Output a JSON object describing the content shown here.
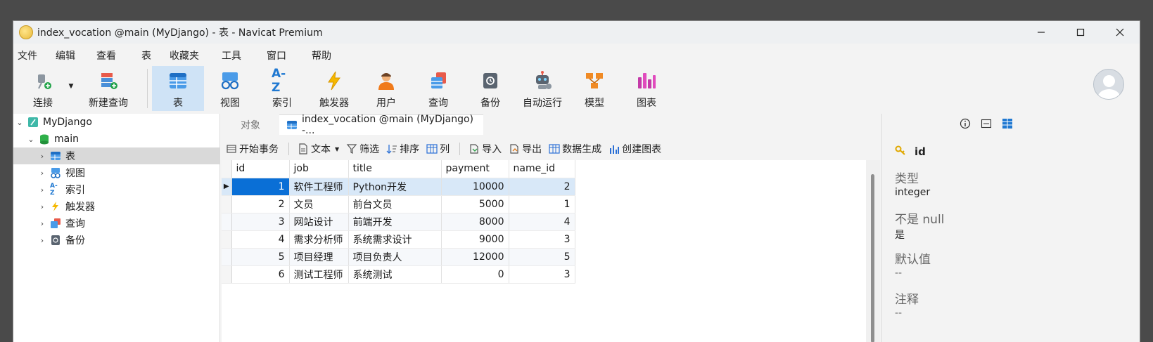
{
  "window": {
    "title": "index_vocation @main (MyDjango) - 表 - Navicat Premium",
    "controls": {
      "minimize": "—",
      "maximize": "☐",
      "close": "✕"
    }
  },
  "menu": [
    "文件",
    "编辑",
    "查看",
    "表",
    "收藏夹",
    "工具",
    "窗口",
    "帮助"
  ],
  "toolbar": {
    "connect": "连接",
    "new_query": "新建查询",
    "table": "表",
    "view": "视图",
    "index": "索引",
    "trigger": "触发器",
    "user": "用户",
    "query": "查询",
    "backup": "备份",
    "auto_run": "自动运行",
    "model": "模型",
    "chart": "图表",
    "index_icon_text": "A-Z"
  },
  "sidebar": {
    "connection": "MyDjango",
    "database": "main",
    "items": [
      "表",
      "视图",
      "索引",
      "触发器",
      "查询",
      "备份"
    ]
  },
  "tabs": {
    "objects": "对象",
    "active": "index_vocation @main (MyDjango) -..."
  },
  "obj_toolbar": {
    "begin_tx": "开始事务",
    "text": "文本",
    "filter": "筛选",
    "sort": "排序",
    "columns": "列",
    "import": "导入",
    "export": "导出",
    "data_gen": "数据生成",
    "create_chart": "创建图表"
  },
  "table": {
    "columns": [
      "id",
      "job",
      "title",
      "payment",
      "name_id"
    ],
    "rows": [
      [
        "1",
        "软件工程师",
        "Python开发",
        "10000",
        "2"
      ],
      [
        "2",
        "文员",
        "前台文员",
        "5000",
        "1"
      ],
      [
        "3",
        "网站设计",
        "前端开发",
        "8000",
        "4"
      ],
      [
        "4",
        "需求分析师",
        "系统需求设计",
        "9000",
        "3"
      ],
      [
        "5",
        "项目经理",
        "项目负责人",
        "12000",
        "5"
      ],
      [
        "6",
        "测试工程师",
        "系统测试",
        "0",
        "3"
      ]
    ]
  },
  "field_panel": {
    "field_name": "id",
    "type_label": "类型",
    "type_value": "integer",
    "notnull_label": "不是 null",
    "notnull_value": "是",
    "default_label": "默认值",
    "default_value": "--",
    "comment_label": "注释",
    "comment_value": "--"
  },
  "colors": {
    "accent": "#0a6fd6",
    "selected_row": "#d8e8f8",
    "active_tool": "#cfe3f6"
  }
}
